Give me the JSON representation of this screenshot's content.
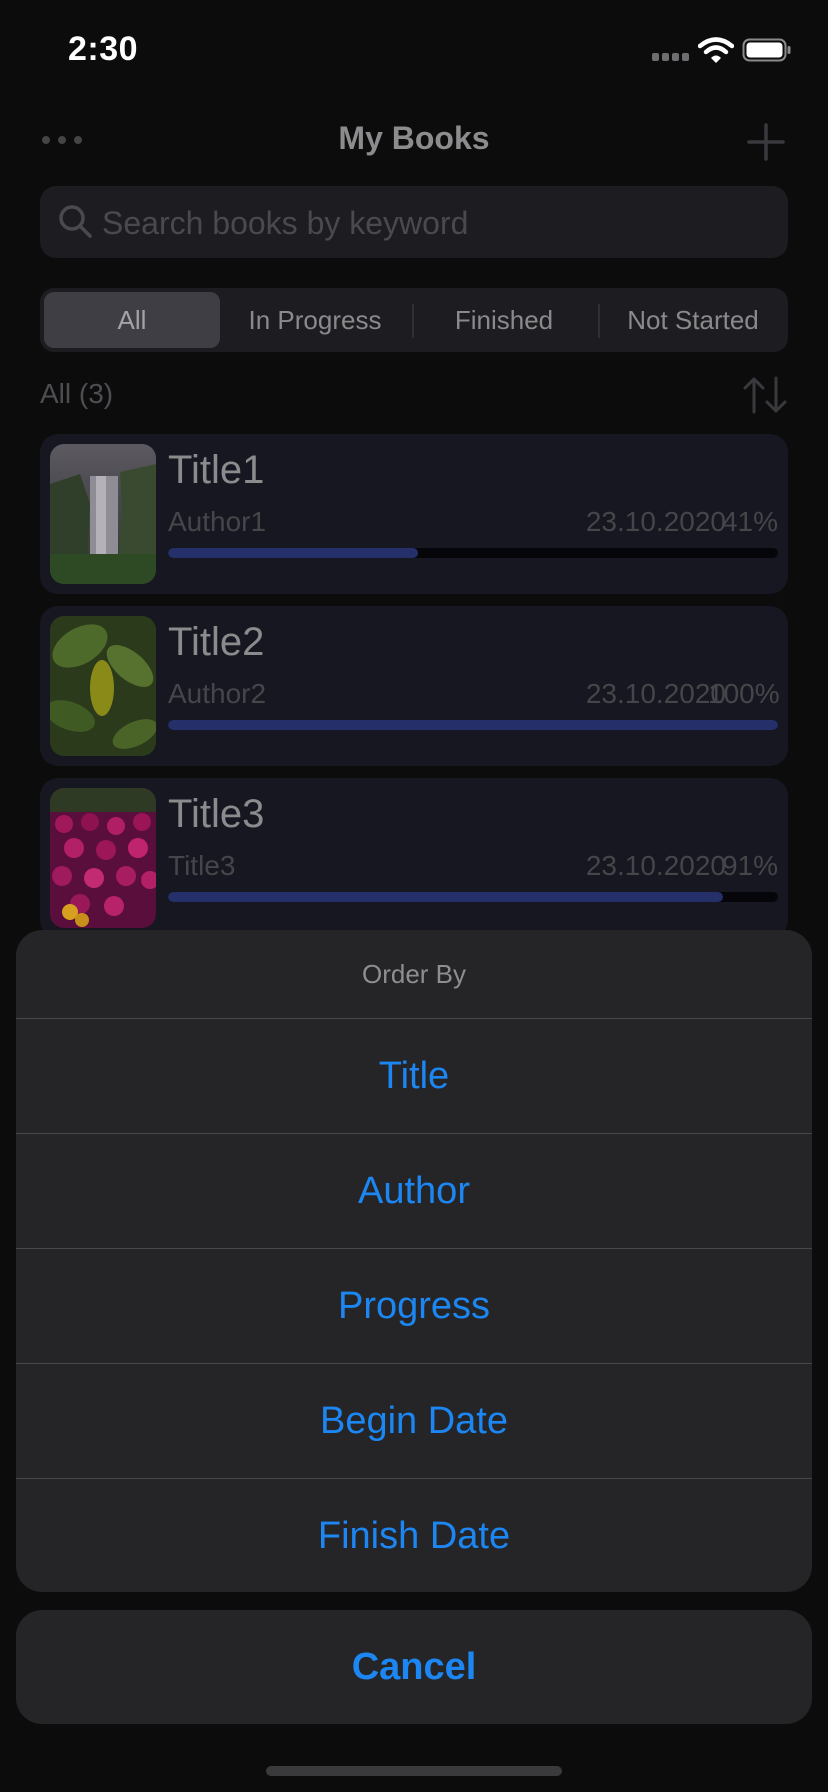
{
  "status_bar": {
    "time": "2:30"
  },
  "nav": {
    "title": "My Books"
  },
  "search": {
    "placeholder": "Search books by keyword",
    "value": ""
  },
  "filters": {
    "tabs": [
      {
        "label": "All",
        "selected": true
      },
      {
        "label": "In Progress",
        "selected": false
      },
      {
        "label": "Finished",
        "selected": false
      },
      {
        "label": "Not Started",
        "selected": false
      }
    ]
  },
  "list": {
    "count_label": "All (3)",
    "books": [
      {
        "title": "Title1",
        "author": "Author1",
        "date": "23.10.2020",
        "progress_label": "41%",
        "progress": 0.41,
        "cover": "waterfall-image"
      },
      {
        "title": "Title2",
        "author": "Author2",
        "date": "23.10.2020",
        "progress_label": "100%",
        "progress": 1.0,
        "cover": "leaves-image"
      },
      {
        "title": "Title3",
        "author": "Title3",
        "date": "23.10.2020",
        "progress_label": "91%",
        "progress": 0.91,
        "cover": "flowers-image"
      }
    ]
  },
  "action_sheet": {
    "header": "Order By",
    "options": [
      "Title",
      "Author",
      "Progress",
      "Begin Date",
      "Finish Date"
    ],
    "cancel_label": "Cancel"
  },
  "colors": {
    "accent": "#1c86f2",
    "progress_fill": "#25306a",
    "card_background": "#161720"
  },
  "icons": [
    "signal-icon",
    "wifi-icon",
    "battery-icon",
    "more-icon",
    "add-icon",
    "search-icon",
    "sort-icon"
  ]
}
